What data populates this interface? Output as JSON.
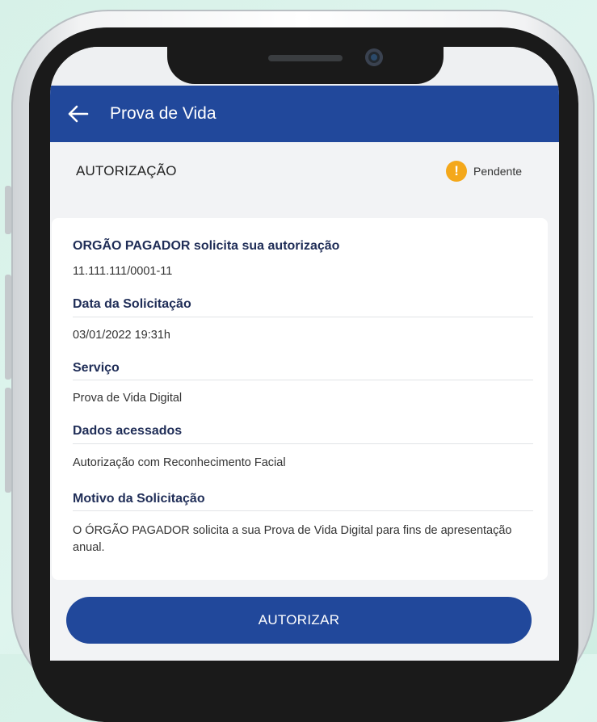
{
  "app_bar": {
    "title": "Prova de Vida",
    "back_icon": "arrow-left-icon"
  },
  "status": {
    "label": "AUTORIZAÇÃO",
    "badge_text": "Pendente",
    "badge_icon": "exclamation-icon",
    "badge_color": "#f4a81b"
  },
  "card": {
    "requester_label": "ORGÃO PAGADOR solicita sua autorização",
    "requester_id": "11.111.111/0001-11",
    "fields": [
      {
        "label": "Data da Solicitação",
        "value": "03/01/2022 19:31h"
      },
      {
        "label": "Serviço",
        "value": "Prova de Vida Digital"
      },
      {
        "label": "Dados acessados",
        "value": "Autorização com Reconhecimento Facial"
      },
      {
        "label": "Motivo da Solicitação",
        "value": "O ÓRGÃO PAGADOR solicita a sua Prova de Vida Digital para fins de apresentação anual."
      }
    ]
  },
  "action": {
    "authorize_label": "AUTORIZAR"
  },
  "colors": {
    "primary": "#21489b",
    "background": "#dff5ee"
  }
}
